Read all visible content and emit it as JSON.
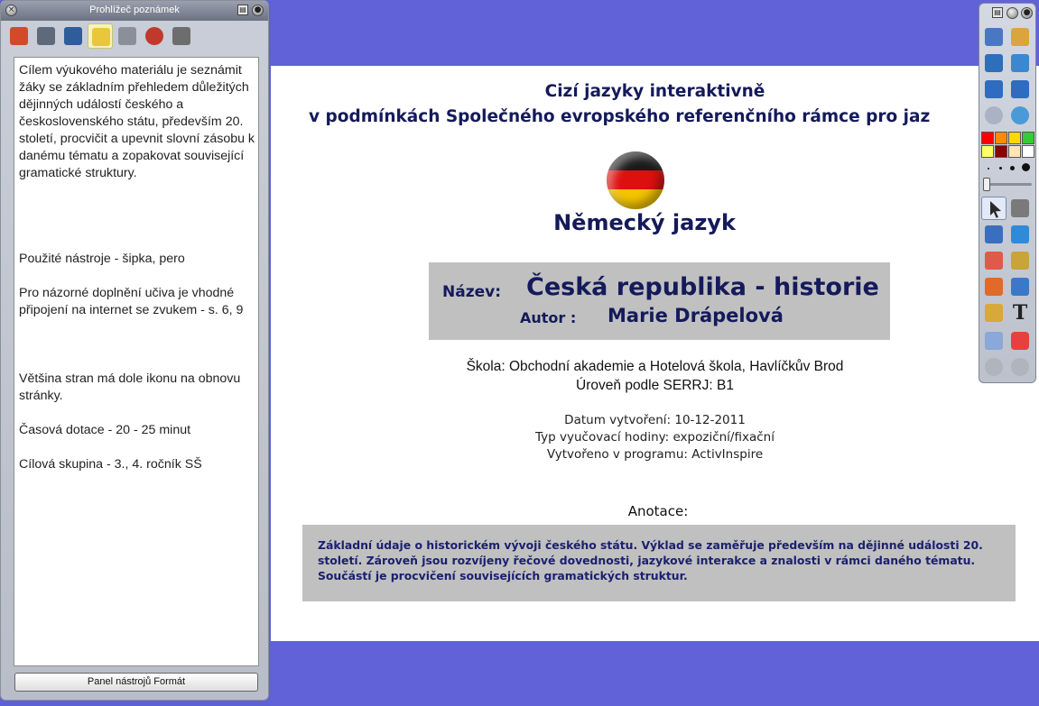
{
  "notes_panel": {
    "title": "Prohlížeč poznámek",
    "close_glyph": "×",
    "menu_glyph": "▤",
    "pin_glyph": "●",
    "tabs": [
      {
        "icon": "pages-icon",
        "color": "#d24a2a"
      },
      {
        "icon": "resources-icon",
        "color": "#5e6a7c"
      },
      {
        "icon": "objects-icon",
        "color": "#2e5d9a"
      },
      {
        "icon": "notes-icon",
        "color": "#e8c83a"
      },
      {
        "icon": "properties-icon",
        "color": "#8a8f9a"
      },
      {
        "icon": "actions-icon",
        "color": "#c0392b"
      },
      {
        "icon": "voting-icon",
        "color": "#6d6d6d"
      }
    ],
    "notes": {
      "para1": "Cílem výukového materiálu je seznámit žáky se základním přehledem důležitých dějinných událostí  českého a československého státu, především 20.  století, procvičit a upevnit slovní zásobu k danému tématu a zopakovat související gramatické struktury.",
      "tools": "Použité nástroje - šipka, pero",
      "internet": "Pro názorné doplnění učiva je vhodné připojení na internet se zvukem - s. 6, 9",
      "refresh": "Většina stran má  dole ikonu na obnovu stránky.",
      "time": "Časová dotace - 20 - 25 minut",
      "target": "Cílová skupina - 3., 4. ročník SŠ"
    },
    "format_button": "Panel nástrojů Formát"
  },
  "slide": {
    "title_line1": "Cizí jazyky interaktivně",
    "title_line2": "v podmínkách Společného evropského referenčního rámce pro jaz",
    "flag_icon": "germany-flag-icon",
    "language": "Německý  jazyk",
    "name_label": "Název:",
    "name_value": "Česká republika - historie",
    "author_label": "Autor :",
    "author_value": "Marie Drápelová",
    "school": "Škola:  Obchodní akademie a Hotelová škola, Havlíčkův Brod",
    "level": "Úroveň podle SERRJ: B1",
    "created": "Datum vytvoření: 10-12-2011",
    "lesson_type": "Typ vyučovací hodiny: expoziční/fixační",
    "program": "Vytvořeno v programu: ActivInspire",
    "annotation_title": "Anotace:",
    "annotation_line1": "Základní údaje o historickém vývoji českého státu. Výklad se zaměřuje především na dějinné události 20.",
    "annotation_line2": "století. Zároveň jsou rozvíjeny řečové dovednosti, jazykové interakce a znalosti v rámci daného tématu.",
    "annotation_line3": "Součástí je procvičení souvisejících gramatických struktur."
  },
  "toolbox": {
    "glyph_text": "T",
    "colors": [
      "#ff0000",
      "#ff8c00",
      "#ffd700",
      "#32cd32",
      "#ffff66",
      "#8b0000",
      "#ffe4b5",
      "#ffffff"
    ],
    "tools": [
      {
        "icon": "page-browser-icon"
      },
      {
        "icon": "resource-browser-icon"
      },
      {
        "icon": "handwriting-icon"
      },
      {
        "icon": "tools-icon"
      },
      {
        "icon": "previous-page-icon"
      },
      {
        "icon": "next-page-icon"
      },
      {
        "icon": "play-icon"
      },
      {
        "icon": "globe-icon"
      },
      {
        "icon": "select-arrow-icon"
      },
      {
        "icon": "magic-tool-icon"
      },
      {
        "icon": "pen-icon"
      },
      {
        "icon": "highlighter-icon"
      },
      {
        "icon": "eraser-icon"
      },
      {
        "icon": "fill-icon"
      },
      {
        "icon": "shape-icon"
      },
      {
        "icon": "connector-icon"
      },
      {
        "icon": "camera-icon"
      },
      {
        "icon": "text-icon"
      },
      {
        "icon": "clear-icon"
      },
      {
        "icon": "reset-page-icon"
      },
      {
        "icon": "undo-icon"
      },
      {
        "icon": "redo-icon"
      }
    ]
  }
}
